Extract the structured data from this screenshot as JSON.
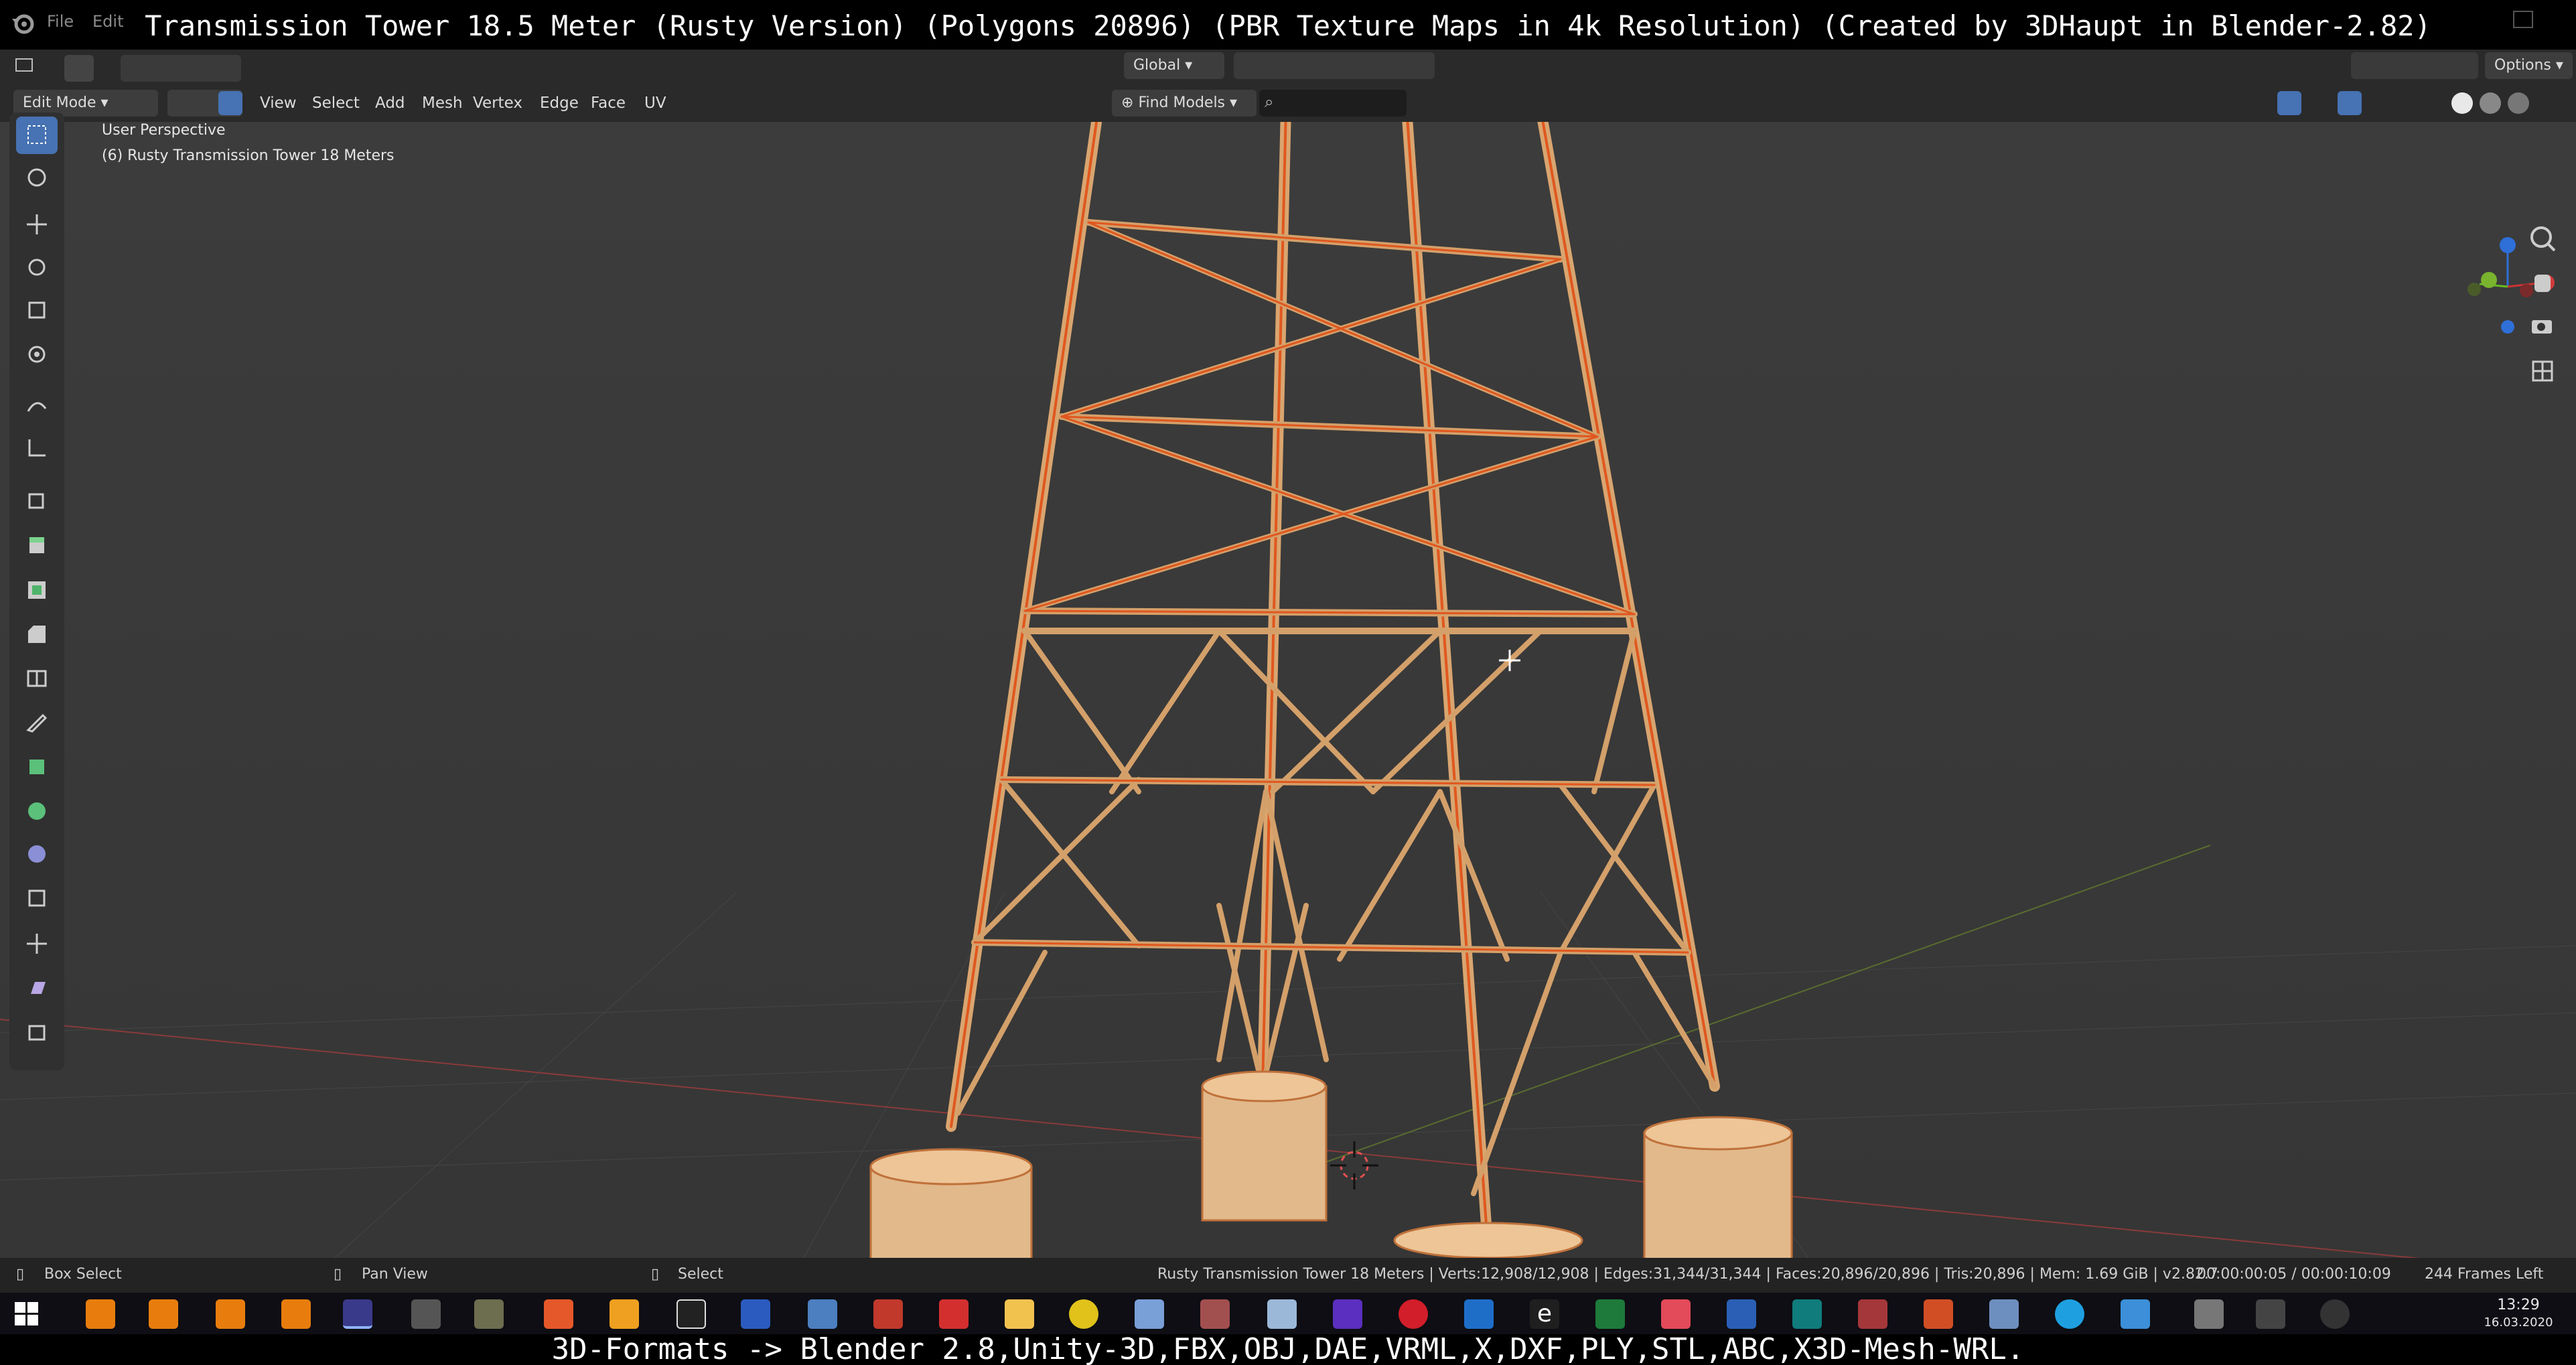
{
  "overlay": {
    "title": "Transmission Tower 18.5 Meter (Rusty Version) (Polygons 20896) (PBR Texture Maps in 4k Resolution) (Created by 3DHaupt in Blender-2.82)",
    "bottom": "3D-Formats -> Blender 2.8,Unity-3D,FBX,OBJ,DAE,VRML,X,DXF,PLY,STL,ABC,X3D-Mesh-WRL."
  },
  "topbar": {
    "file": "File",
    "edit": "Edit"
  },
  "header": {
    "mode": "Edit Mode",
    "menus": [
      "View",
      "Select",
      "Add",
      "Mesh",
      "Vertex",
      "Edge",
      "Face",
      "UV"
    ],
    "orientation": "Global",
    "find_models": "Find Models",
    "options": "Options"
  },
  "viewport": {
    "perspective": "User Perspective",
    "object": "(6) Rusty Transmission Tower 18 Meters"
  },
  "toolbar": {
    "icons": [
      "box-select-icon",
      "cursor-icon",
      "move-icon",
      "rotate-icon",
      "scale-icon",
      "transform-icon",
      "annotate-icon",
      "measure-icon",
      "add-cube-icon",
      "extrude-icon",
      "inset-icon",
      "bevel-icon",
      "loop-cut-icon",
      "knife-icon",
      "poly-build-icon",
      "spin-icon",
      "smooth-icon",
      "edge-slide-icon",
      "shrink-fatten-icon",
      "shear-icon",
      "rip-icon"
    ]
  },
  "status": {
    "left1": "Box Select",
    "left2": "Pan View",
    "left3": "Select",
    "stats": "Rusty Transmission Tower 18 Meters | Verts:12,908/12,908 | Edges:31,344/31,344 | Faces:20,896/20,896 | Tris:20,896 | Mem: 1.69 GiB | v2.82.7",
    "time": "00:00:00:05 / 00:00:10:09",
    "frames": "244 Frames Left"
  },
  "taskbar": {
    "time": "13:29",
    "date": "16.03.2020",
    "apps": [
      "blender",
      "blender",
      "blender",
      "blender",
      "blender-active",
      "unity",
      "gimp",
      "firefox",
      "flame",
      "terminal",
      "floppy",
      "network",
      "tools",
      "pdf",
      "folder",
      "xbox",
      "notes",
      "toolset",
      "paper",
      "gem",
      "opera",
      "outlook",
      "edge",
      "excel",
      "vector",
      "word",
      "publisher",
      "access",
      "powerpoint",
      "calc",
      "skype",
      "pen",
      "crane",
      "unity2",
      "circle"
    ]
  },
  "colors": {
    "accent": "#4772b3",
    "wire": "#e0571f",
    "metal": "#d8a46e",
    "grid": "#474747"
  }
}
